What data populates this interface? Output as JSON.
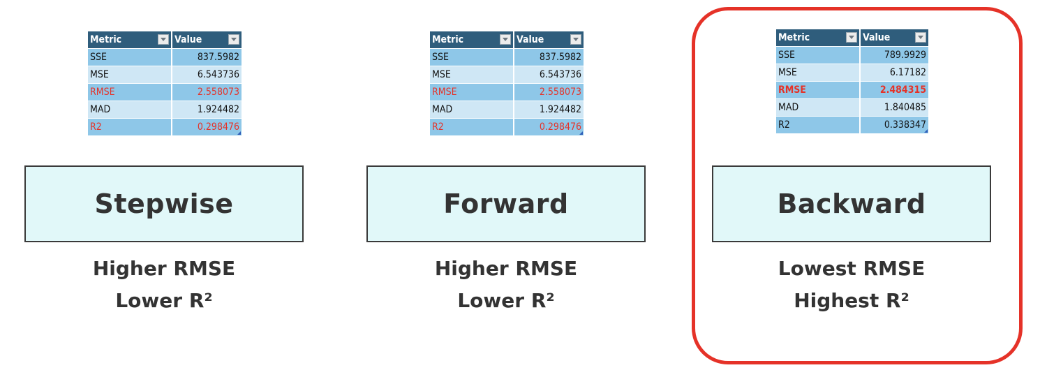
{
  "table_headers": {
    "metric": "Metric",
    "value": "Value"
  },
  "panels": [
    {
      "method": "Stepwise",
      "rows": [
        {
          "metric": "SSE",
          "value": "837.5982"
        },
        {
          "metric": "MSE",
          "value": "6.543736"
        },
        {
          "metric": "RMSE",
          "value": "2.558073"
        },
        {
          "metric": "MAD",
          "value": "1.924482"
        },
        {
          "metric": "R2",
          "value": "0.298476"
        }
      ],
      "caption_line1": "Higher RMSE",
      "caption_line2": "Lower R²"
    },
    {
      "method": "Forward",
      "rows": [
        {
          "metric": "SSE",
          "value": "837.5982"
        },
        {
          "metric": "MSE",
          "value": "6.543736"
        },
        {
          "metric": "RMSE",
          "value": "2.558073"
        },
        {
          "metric": "MAD",
          "value": "1.924482"
        },
        {
          "metric": "R2",
          "value": "0.298476"
        }
      ],
      "caption_line1": "Higher RMSE",
      "caption_line2": "Lower R²"
    },
    {
      "method": "Backward",
      "rows": [
        {
          "metric": "SSE",
          "value": "789.9929"
        },
        {
          "metric": "MSE",
          "value": "6.17182"
        },
        {
          "metric": "RMSE",
          "value": "2.484315"
        },
        {
          "metric": "MAD",
          "value": "1.840485"
        },
        {
          "metric": "R2",
          "value": "0.338347"
        }
      ],
      "caption_line1": "Lowest RMSE",
      "caption_line2": "Highest R²"
    }
  ],
  "colors": {
    "highlight": "#e53228",
    "header_bg": "#2f5d7c",
    "row_dark": "#8ec7e8",
    "row_light": "#cfe7f5",
    "box_bg": "#e1f8f9"
  }
}
